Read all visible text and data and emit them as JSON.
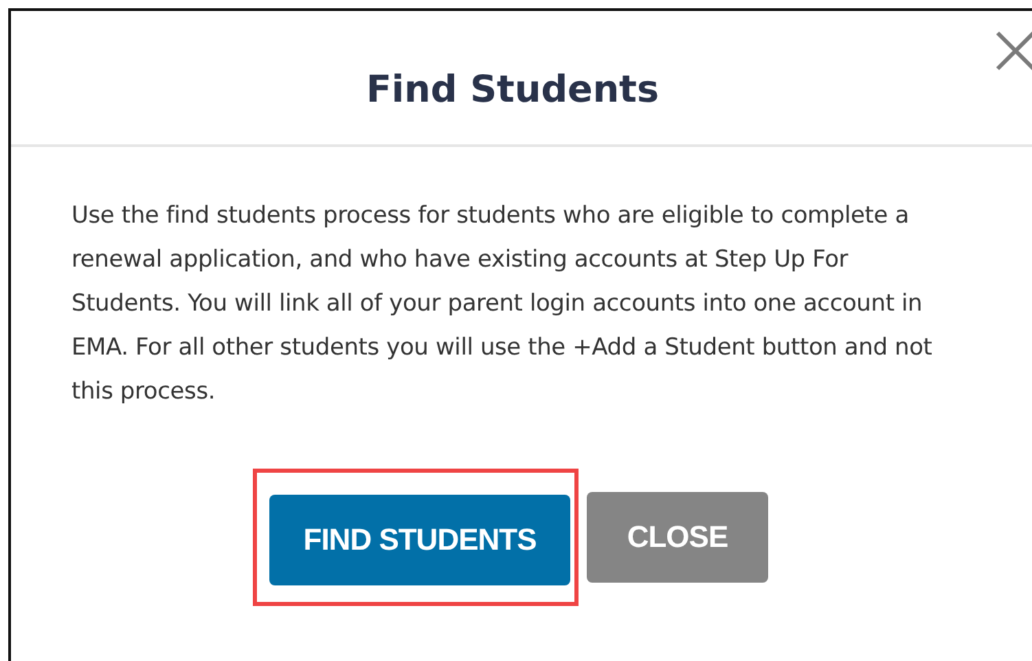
{
  "dialog": {
    "title": "Find Students",
    "close_icon": true,
    "message": "Use the find students process for students who are eligible to complete a renewal application, and who have existing accounts at Step Up For Students. You will link all of your parent login accounts into one account in EMA. For all other students you will use the +Add a Student button and not this process.",
    "buttons": [
      {
        "label": "FIND STUDENTS",
        "kind": "primary",
        "highlighted": true
      },
      {
        "label": "CLOSE",
        "kind": "secondary",
        "highlighted": false
      }
    ]
  }
}
